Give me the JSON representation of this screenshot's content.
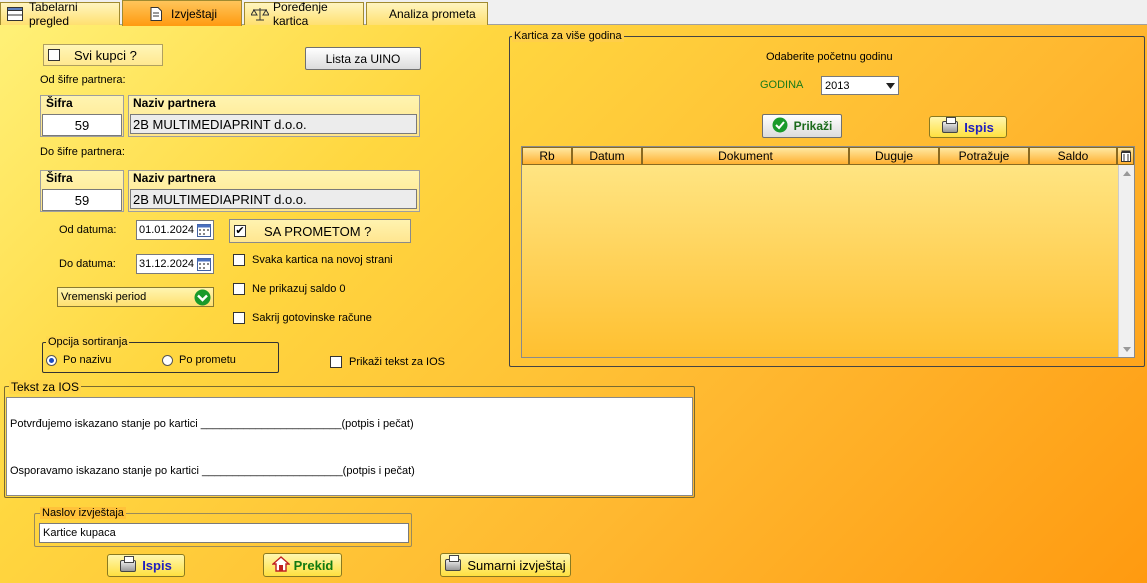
{
  "tabs": [
    {
      "label": "Tabelarni pregled",
      "icon": "table-icon"
    },
    {
      "label": "Izvještaji",
      "icon": "document-icon"
    },
    {
      "label": "Poređenje kartica",
      "icon": "scales-icon"
    },
    {
      "label": "Analiza prometa",
      "icon": ""
    }
  ],
  "left": {
    "svi_kupci": "Svi kupci ?",
    "lista_uino": "Lista za UINO",
    "od_sifre_label": "Od šifre partnera:",
    "do_sifre_label": "Do šifre partnera:",
    "sifra_label": "Šifra",
    "naziv_label": "Naziv partnera",
    "od_sifra": "59",
    "od_naziv": "2B MULTIMEDIAPRINT d.o.o.",
    "do_sifra": "59",
    "do_naziv": "2B MULTIMEDIAPRINT d.o.o.",
    "od_datuma_label": "Od datuma:",
    "do_datuma_label": "Do datuma:",
    "od_datuma": "01.01.2024",
    "do_datuma": "31.12.2024",
    "period": "Vremenski period",
    "sa_prometom": "SA PROMETOM ?",
    "svaka_kartica": "Svaka kartica na novoj strani",
    "ne_prikazuj_saldo": "Ne prikazuj saldo 0",
    "sakrij_racune": "Sakrij gotovinske račune",
    "sort_title": "Opcija sortiranja",
    "sort_naziv": "Po nazivu",
    "sort_promet": "Po prometu",
    "prikazi_tekst_ios": "Prikaži tekst za IOS"
  },
  "ios": {
    "title": "Tekst za IOS",
    "line1": "Potvrđujemo iskazano stanje po kartici _______________________(potpis i pečat)",
    "line2": "Osporavamo iskazano stanje po kartici _______________________(potpis i pečat)"
  },
  "naslov": {
    "title": "Naslov izvještaja",
    "value": "Kartice kupaca"
  },
  "bottom": {
    "ispis": "Ispis",
    "prekid": "Prekid",
    "sumarni": "Sumarni izvještaj"
  },
  "right": {
    "title": "Kartica za više godina",
    "odaberite": "Odaberite početnu godinu",
    "godina_label": "GODINA",
    "godina": "2013",
    "prikazi": "Prikaži",
    "ispis": "Ispis",
    "columns": [
      "Rb",
      "Datum",
      "Dokument",
      "Duguje",
      "Potražuje",
      "Saldo"
    ]
  }
}
